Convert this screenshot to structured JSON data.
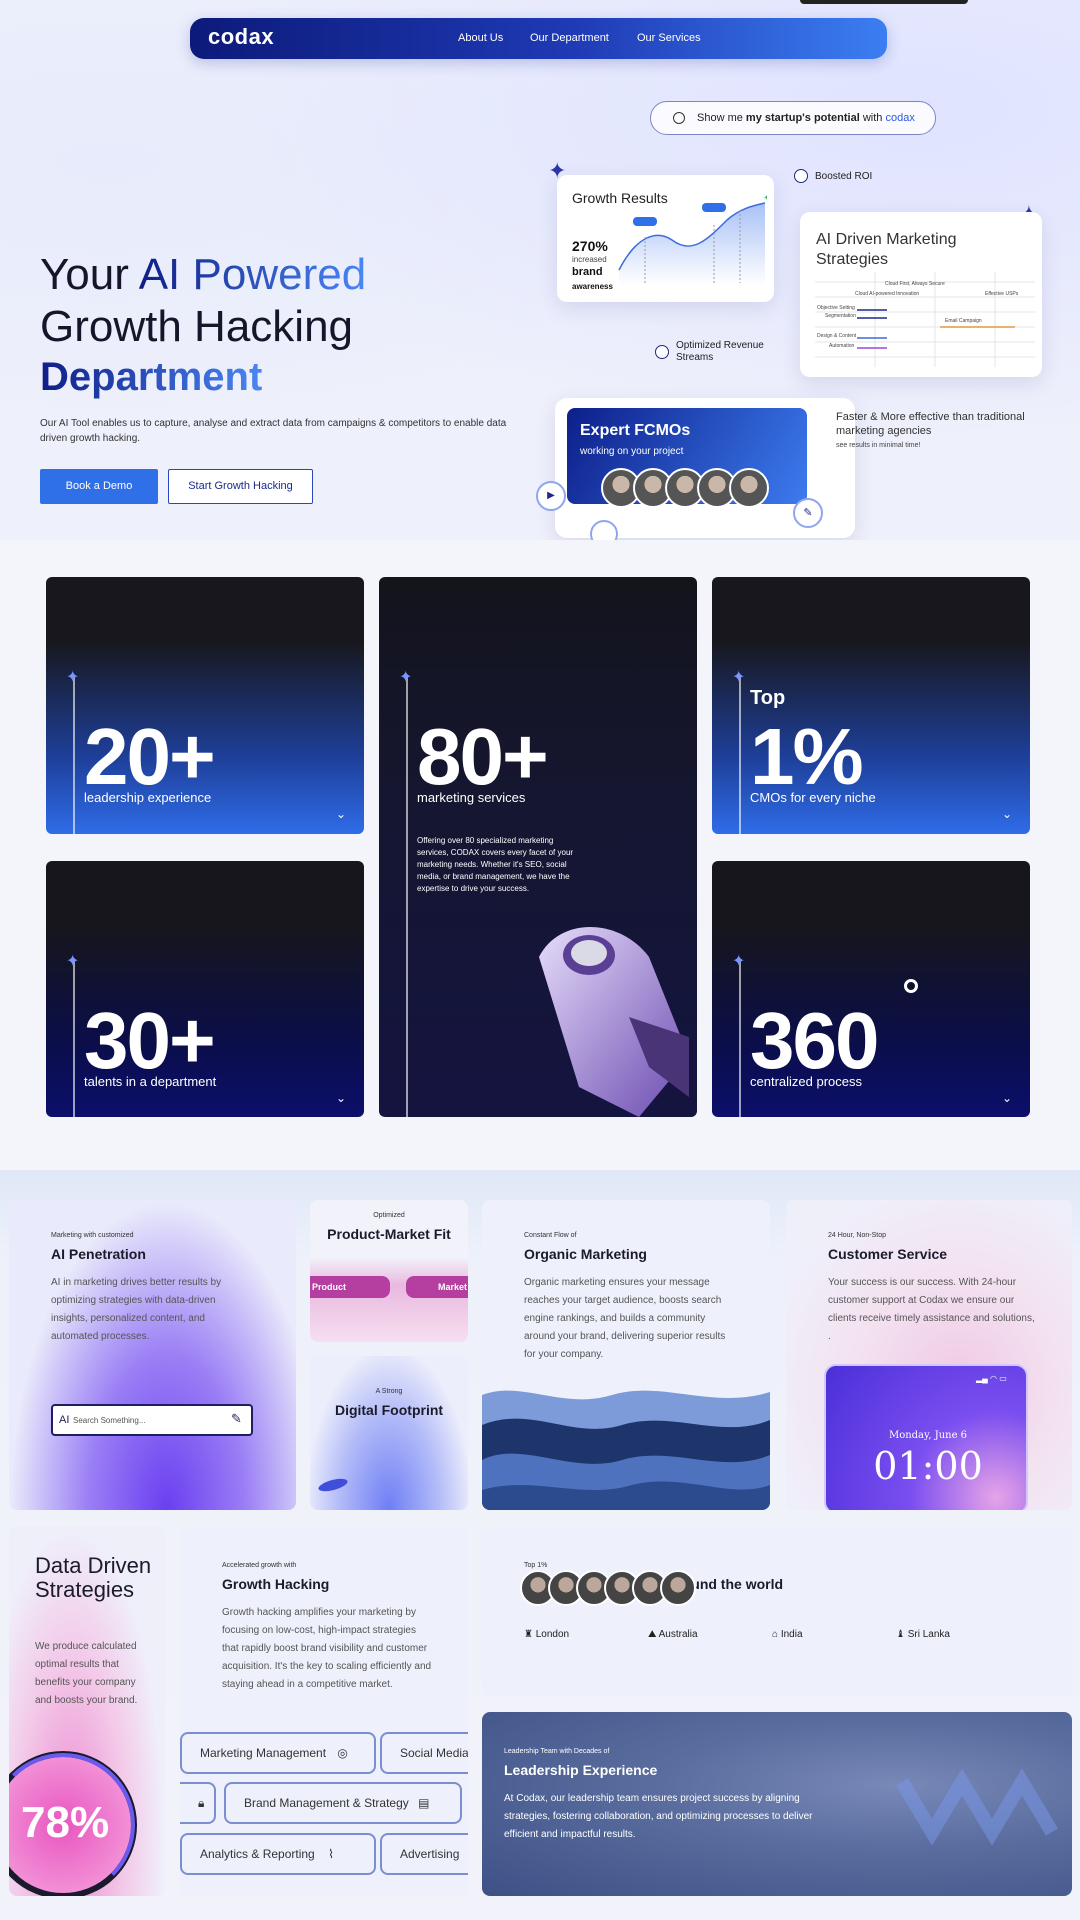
{
  "nav": {
    "logo": "codax",
    "links": [
      "About Us",
      "Our Department",
      "Our Services"
    ]
  },
  "search_pill": {
    "text_pre": "Show me ",
    "text_bold": "my startup's potential",
    "text_post": " with ",
    "brand": "codax"
  },
  "hero": {
    "line1_a": "Your ",
    "line1_b": "AI Powered",
    "line2": "Growth Hacking",
    "line3": "Department",
    "desc": "Our AI Tool enables us to capture, analyse and extract data from campaigns & competitors to enable data driven growth hacking.",
    "btn_demo": "Book a Demo",
    "btn_start": "Start Growth Hacking"
  },
  "growth_card": {
    "title": "Growth Results",
    "pct": "270%",
    "sub1": "increased",
    "sub2": "brand",
    "sub3": "awareness"
  },
  "boosted": "Boosted ROI",
  "ai_card": {
    "title": "AI Driven Marketing Strategies",
    "labels": [
      "Cloud First, Always Secure",
      "Cloud AI-powered Innovation",
      "Effective USPs",
      "Objective Setting",
      "Segmentation",
      "Email Campaign",
      "Design & Content",
      "Automation"
    ]
  },
  "optimized": "Optimized Revenue Streams",
  "fcmo": {
    "title": "Expert FCMOs",
    "sub": "working on your project"
  },
  "faster": {
    "title": "Faster & More effective than traditional marketing agencies",
    "sub": "see results in minimal time!"
  },
  "stats": [
    {
      "num": "20+",
      "cap": "leadership experience"
    },
    {
      "num": "80+",
      "cap": "marketing services",
      "desc": "Offering over 80 specialized marketing services, CODAX covers every facet of your marketing needs. Whether it's SEO, social media, or brand management, we have the expertise to drive your success."
    },
    {
      "top": "Top",
      "num": "1%",
      "cap": "CMOs for every niche"
    },
    {
      "num": "30+",
      "cap": "talents in a department"
    },
    {
      "num": "360",
      "cap": "centralized process"
    }
  ],
  "features": {
    "ai_pen": {
      "pre": "Marketing with customized",
      "title": "AI Penetration",
      "body": "AI in marketing drives better results by optimizing strategies with data-driven insights, personalized content, and automated processes.",
      "search_placeholder": "Search Something...",
      "ai_label": "AI"
    },
    "pmf": {
      "pre": "Optimized",
      "title": "Product-Market Fit",
      "tag_left": "Product",
      "tag_right": "Market"
    },
    "digital": {
      "pre": "A Strong",
      "title": "Digital Footprint"
    },
    "organic": {
      "pre": "Constant Flow of",
      "title": "Organic Marketing",
      "body": "Organic marketing ensures your message reaches your target audience, boosts search engine rankings, and builds a community around your brand, delivering superior results for your company."
    },
    "customer": {
      "pre": "24 Hour, Non-Stop",
      "title": "Customer Service",
      "body": "Your success is our success. With 24-hour customer support at Codax we ensure our clients receive timely assistance and solutions, .",
      "phone_date": "Monday, June 6",
      "phone_time": "01:00"
    },
    "data": {
      "title": "Data Driven Strategies",
      "body": "We produce calculated optimal results that benefits your company and boosts your brand.",
      "pct": "78%"
    },
    "growth": {
      "pre": "Accelerated growth with",
      "title": "Growth Hacking",
      "body": "Growth hacking amplifies your marketing by focusing on low-cost, high-impact strategies that rapidly boost brand visibility and customer acquisition. It's the key to scaling efficiently and staying ahead in a competitive market.",
      "chips": [
        "Marketing Management",
        "Social Media",
        "Brand Management & Strategy",
        "Analytics & Reporting",
        "Advertising"
      ]
    },
    "domain": {
      "pre": "Top 1%",
      "title": "Domain Experts from around the world",
      "cities": [
        "London",
        "Australia",
        "India",
        "Sri Lanka"
      ]
    },
    "leader": {
      "pre": "Leadership Team with Decades of",
      "title": "Leadership Experience",
      "body": "At Codax, our leadership team ensures project success by aligning strategies, fostering collaboration, and optimizing processes to deliver efficient and impactful results."
    }
  }
}
